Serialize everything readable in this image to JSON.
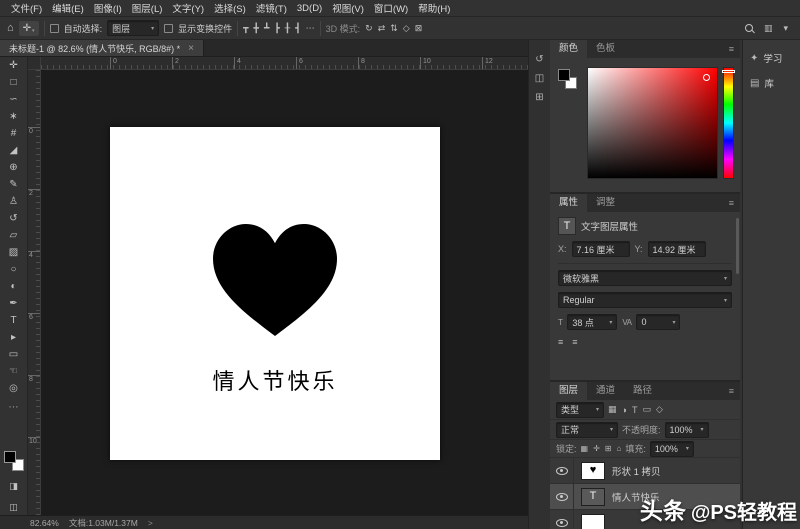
{
  "icons": {
    "home": "⌂",
    "move_tool": "✛",
    "caret": "▾",
    "workspace": "▥",
    "chevron": "▾",
    "panel_menu": "≡",
    "tool_more": "⋯",
    "quick_mask": "◨",
    "screen_mode": "◫"
  },
  "menubar": {
    "items": [
      {
        "name": "menu-file",
        "label": "文件(F)"
      },
      {
        "name": "menu-edit",
        "label": "编辑(E)"
      },
      {
        "name": "menu-image",
        "label": "图像(I)"
      },
      {
        "name": "menu-layer",
        "label": "图层(L)"
      },
      {
        "name": "menu-type",
        "label": "文字(Y)"
      },
      {
        "name": "menu-select",
        "label": "选择(S)"
      },
      {
        "name": "menu-filter",
        "label": "滤镜(T)"
      },
      {
        "name": "menu-3d",
        "label": "3D(D)"
      },
      {
        "name": "menu-view",
        "label": "视图(V)"
      },
      {
        "name": "menu-window",
        "label": "窗口(W)"
      },
      {
        "name": "menu-help",
        "label": "帮助(H)"
      }
    ]
  },
  "options_bar": {
    "auto_select_label": "自动选择:",
    "auto_select_value": "图层",
    "show_transform_label": "显示变换控件",
    "more_glyph": "⋯",
    "mode_label": "3D 模式:",
    "align_icons": [
      {
        "name": "align-top-edges-icon",
        "glyph": "┳"
      },
      {
        "name": "align-vertical-centers-icon",
        "glyph": "╋"
      },
      {
        "name": "align-bottom-edges-icon",
        "glyph": "┻"
      },
      {
        "name": "align-left-edges-icon",
        "glyph": "┣"
      },
      {
        "name": "align-horizontal-centers-icon",
        "glyph": "╂"
      },
      {
        "name": "align-right-edges-icon",
        "glyph": "┫"
      }
    ],
    "mode_icons": [
      {
        "name": "3d-rotate-icon",
        "glyph": "↻"
      },
      {
        "name": "3d-roll-icon",
        "glyph": "⇄"
      },
      {
        "name": "3d-drag-icon",
        "glyph": "⇅"
      },
      {
        "name": "3d-slide-icon",
        "glyph": "◇"
      },
      {
        "name": "3d-scale-icon",
        "glyph": "⊠"
      }
    ]
  },
  "tabbar": {
    "title": "未标题-1 @ 82.6% (情人节快乐, RGB/8#) *",
    "close_glyph": "×"
  },
  "tools": [
    {
      "name": "move-tool",
      "glyph": "✛"
    },
    {
      "name": "rectangular-marquee-tool",
      "glyph": "□"
    },
    {
      "name": "lasso-tool",
      "glyph": "∽"
    },
    {
      "name": "quick-selection-tool",
      "glyph": "∗"
    },
    {
      "name": "crop-tool",
      "glyph": "#"
    },
    {
      "name": "eyedropper-tool",
      "glyph": "◢"
    },
    {
      "name": "spot-healing-brush-tool",
      "glyph": "⊕"
    },
    {
      "name": "brush-tool",
      "glyph": "✎"
    },
    {
      "name": "clone-stamp-tool",
      "glyph": "♙"
    },
    {
      "name": "history-brush-tool",
      "glyph": "↺"
    },
    {
      "name": "eraser-tool",
      "glyph": "▱"
    },
    {
      "name": "gradient-tool",
      "glyph": "▨"
    },
    {
      "name": "blur-tool",
      "glyph": "○"
    },
    {
      "name": "dodge-tool",
      "glyph": "◐"
    },
    {
      "name": "pen-tool",
      "glyph": "✒"
    },
    {
      "name": "type-tool",
      "glyph": "T"
    },
    {
      "name": "path-selection-tool",
      "glyph": "▸"
    },
    {
      "name": "shape-tool",
      "glyph": "▭"
    },
    {
      "name": "hand-tool",
      "glyph": "☜"
    },
    {
      "name": "zoom-tool",
      "glyph": "◎"
    }
  ],
  "rulers": {
    "top": [
      "0",
      "2",
      "4",
      "6",
      "8",
      "10",
      "12"
    ],
    "left": [
      "0",
      "2",
      "4",
      "6",
      "8",
      "10"
    ]
  },
  "canvas": {
    "text": "情人节快乐",
    "heart_color": "#000000",
    "document_bg": "#ffffff"
  },
  "dock_strip": {
    "icons": [
      {
        "name": "collapsed-history-panel-icon",
        "glyph": "↺"
      },
      {
        "name": "collapsed-info-panel-icon",
        "glyph": "◫"
      },
      {
        "name": "collapsed-character-panel-icon",
        "glyph": "⊞"
      }
    ]
  },
  "color_panel": {
    "tabs": [
      {
        "name": "tab-color",
        "label": "颜色",
        "active": true
      },
      {
        "name": "tab-swatches",
        "label": "色板",
        "active": false
      }
    ]
  },
  "properties_panel": {
    "tabs": [
      {
        "name": "tab-properties",
        "label": "属性",
        "active": true
      },
      {
        "name": "tab-adjustments",
        "label": "调整",
        "active": false
      }
    ],
    "title_icon": "T",
    "title": "文字图层属性",
    "transform": {
      "x_label": "X:",
      "x_value": "7.16 厘米",
      "y_label": "Y:",
      "y_value": "14.92 厘米"
    },
    "character": {
      "font_family": "微软雅黑",
      "font_style": "Regular",
      "size_icon": "T",
      "size_value": "38 点",
      "tracking_icon": "VA",
      "tracking_value": "0"
    },
    "align_icons": [
      {
        "name": "text-align-left-icon",
        "glyph": "≡"
      },
      {
        "name": "text-options-icon",
        "glyph": "≡"
      }
    ]
  },
  "layers_panel": {
    "tabs": [
      {
        "name": "tab-layers",
        "label": "图层",
        "active": true
      },
      {
        "name": "tab-channels",
        "label": "通道",
        "active": false
      },
      {
        "name": "tab-paths",
        "label": "路径",
        "active": false
      }
    ],
    "filter_label": "类型",
    "filter_icons": [
      {
        "name": "filter-pixel-layers-icon",
        "glyph": "▦"
      },
      {
        "name": "filter-adjustment-layers-icon",
        "glyph": "◑"
      },
      {
        "name": "filter-type-layers-icon",
        "glyph": "T"
      },
      {
        "name": "filter-shape-layers-icon",
        "glyph": "▭"
      },
      {
        "name": "filter-smart-objects-icon",
        "glyph": "◇"
      }
    ],
    "blend_mode": "正常",
    "opacity_label": "不透明度:",
    "opacity_value": "100%",
    "lock_label": "锁定:",
    "lock_icons": [
      {
        "name": "lock-transparent-pixels-icon",
        "glyph": "▦"
      },
      {
        "name": "lock-image-pixels-icon",
        "glyph": "✛"
      },
      {
        "name": "lock-position-icon",
        "glyph": "⊞"
      },
      {
        "name": "lock-all-icon",
        "glyph": "⌂"
      }
    ],
    "fill_label": "填充:",
    "fill_value": "100%",
    "rows": [
      {
        "name": "layer-row-shape-copy",
        "label": "形状 1 拷贝",
        "thumb": "shape",
        "glyph": "♥",
        "selected": false
      },
      {
        "name": "layer-row-text",
        "label": "情人节快乐",
        "thumb": "text",
        "glyph": "T",
        "selected": true
      },
      {
        "name": "layer-row-background",
        "label": "",
        "thumb": "flat",
        "glyph": "",
        "selected": false
      }
    ]
  },
  "right_dock": {
    "items": [
      {
        "name": "learn-panel-button",
        "glyph": "✦",
        "label": "学习"
      },
      {
        "name": "libraries-panel-button",
        "glyph": "▤",
        "label": "库"
      }
    ]
  },
  "statusbar": {
    "zoom": "82.64%",
    "doc_info": "文档:1.03M/1.37M",
    "expand_glyph": ">"
  },
  "watermark": {
    "brand": "头条",
    "handle": "@PS轻教程"
  }
}
